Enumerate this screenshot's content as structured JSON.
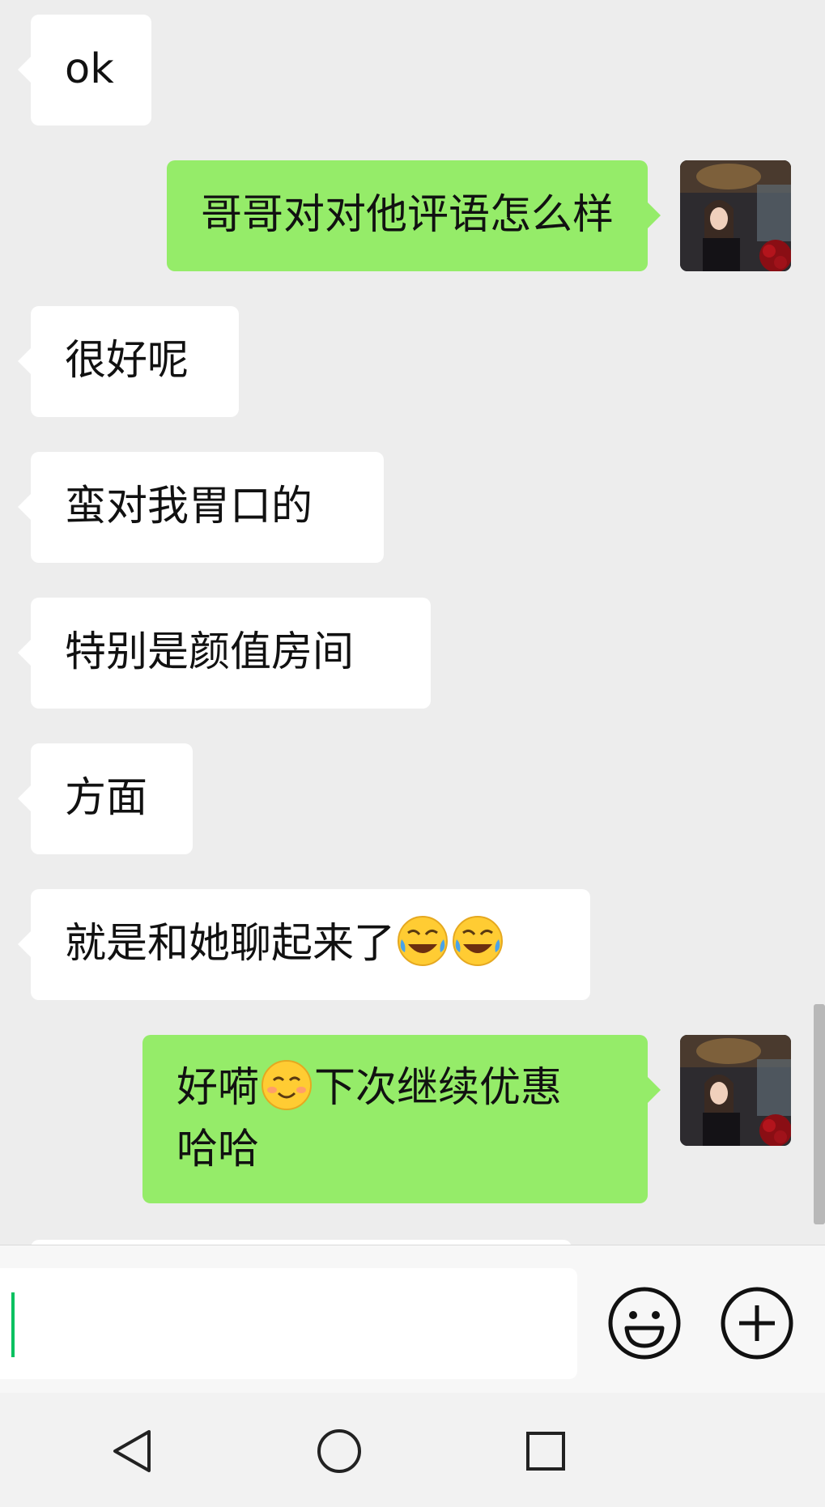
{
  "messages": [
    {
      "from": "them",
      "text": "ok"
    },
    {
      "from": "me",
      "text": "哥哥对对他评语怎么样"
    },
    {
      "from": "them",
      "text": "很好呢"
    },
    {
      "from": "them",
      "text": "蛮对我胃口的"
    },
    {
      "from": "them",
      "text": "特别是颜值房间"
    },
    {
      "from": "them",
      "text": "方面"
    },
    {
      "from": "them",
      "text": "就是和她聊起来了",
      "emojis": [
        "crying-laughing-emoji",
        "crying-laughing-emoji"
      ]
    },
    {
      "from": "me",
      "text_before": "好嗬",
      "emoji": "smiling-face-emoji",
      "text_after": "下次继续优惠",
      "text_line2": "哈哈"
    }
  ],
  "input": {
    "value": "",
    "placeholder": ""
  },
  "toolbar": {
    "emoji_button": "emoji-icon",
    "more_button": "plus-icon"
  },
  "navigation": {
    "back": "back-icon",
    "home": "home-icon",
    "recents": "recents-icon"
  },
  "colors": {
    "sent_bubble": "#95ec69",
    "received_bubble": "#ffffff",
    "background": "#ededed",
    "caret": "#07c160"
  }
}
